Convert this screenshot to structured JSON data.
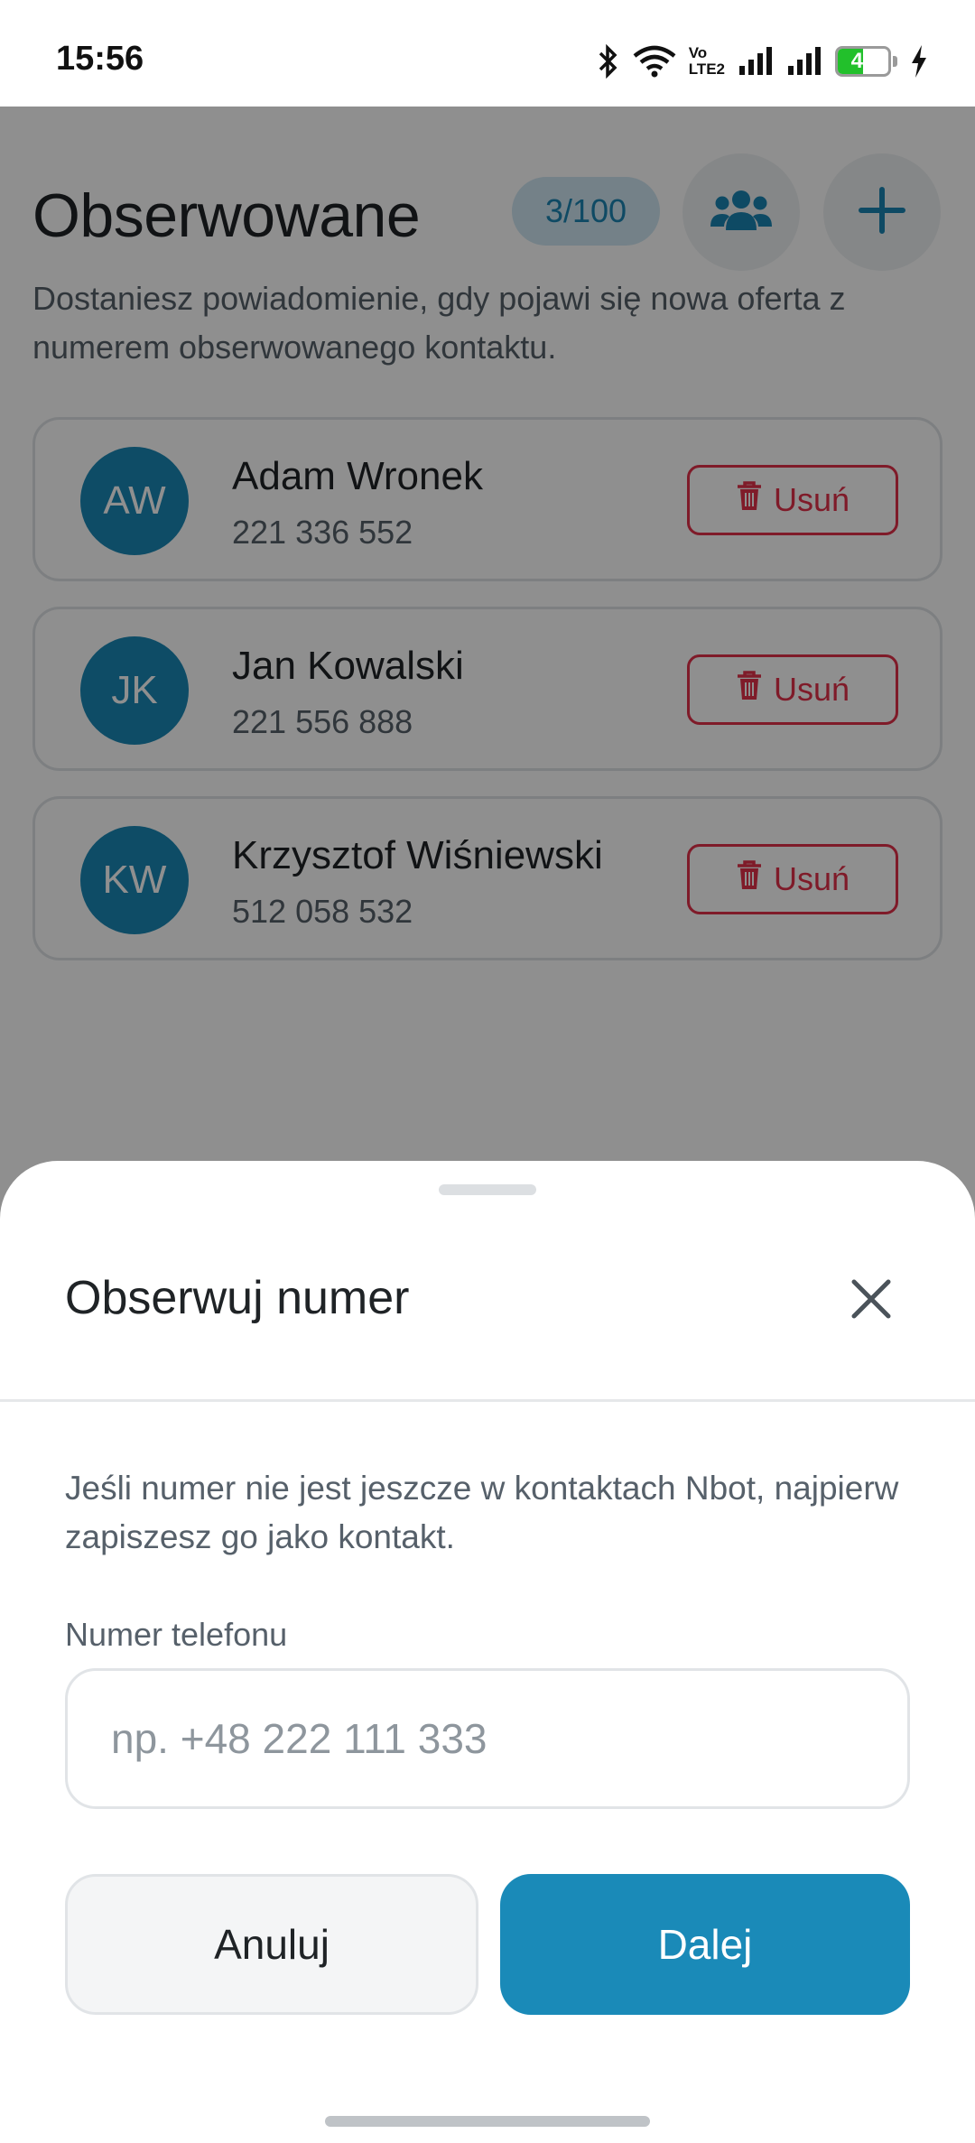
{
  "status_bar": {
    "time": "15:56",
    "network_label_top": "Vo",
    "network_label_bottom": "LTE2",
    "battery_percent": "49"
  },
  "page": {
    "title": "Obserwowane",
    "count_badge": "3/100",
    "group_icon": "users-icon",
    "add_icon": "plus-icon",
    "subtitle": "Dostaniesz powiadomienie, gdy pojawi się nowa oferta z numerem obserwowanego kontaktu.",
    "contacts": [
      {
        "initials": "AW",
        "name": "Adam Wronek",
        "phone": "221 336 552",
        "remove_label": "Usuń"
      },
      {
        "initials": "JK",
        "name": "Jan Kowalski",
        "phone": "221 556 888",
        "remove_label": "Usuń"
      },
      {
        "initials": "KW",
        "name": "Krzysztof Wiśniewski",
        "phone": "512 058 532",
        "remove_label": "Usuń"
      }
    ]
  },
  "sheet": {
    "title": "Obserwuj numer",
    "info": "Jeśli numer nie jest jeszcze w kontaktach Nbot, najpierw zapiszesz go jako kontakt.",
    "phone_label": "Numer telefonu",
    "phone_value": "",
    "phone_placeholder": "np. +48 222 111 333",
    "cancel_label": "Anuluj",
    "next_label": "Dalej"
  },
  "colors": {
    "accent": "#1a8ab8",
    "danger": "#e2304a",
    "badge_bg": "#cfe6f2"
  }
}
